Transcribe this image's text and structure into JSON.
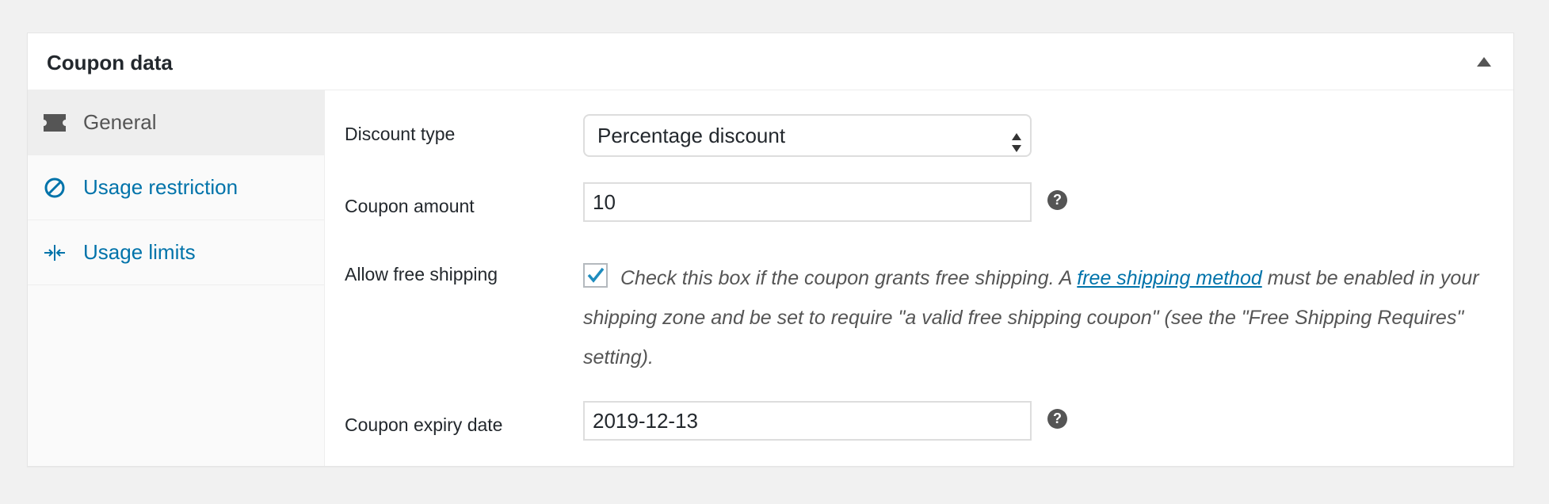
{
  "panel": {
    "title": "Coupon data"
  },
  "tabs": [
    {
      "label": "General",
      "icon": "ticket-icon",
      "active": true
    },
    {
      "label": "Usage restriction",
      "icon": "no-entry-icon",
      "active": false
    },
    {
      "label": "Usage limits",
      "icon": "arrows-in-icon",
      "active": false
    }
  ],
  "fields": {
    "discount_type": {
      "label": "Discount type",
      "value": "Percentage discount"
    },
    "coupon_amount": {
      "label": "Coupon amount",
      "value": "10",
      "help": "?"
    },
    "free_shipping": {
      "label": "Allow free shipping",
      "checked": true,
      "desc_before": "Check this box if the coupon grants free shipping. A ",
      "link_text": "free shipping method",
      "desc_after": " must be enabled in your shipping zone and be set to require \"a valid free shipping coupon\" (see the \"Free Shipping Requires\" setting)."
    },
    "expiry_date": {
      "label": "Coupon expiry date",
      "value": "2019-12-13",
      "help": "?"
    }
  },
  "colors": {
    "link": "#0073aa",
    "text": "#23282d",
    "muted": "#555555",
    "background": "#f1f1f1"
  }
}
